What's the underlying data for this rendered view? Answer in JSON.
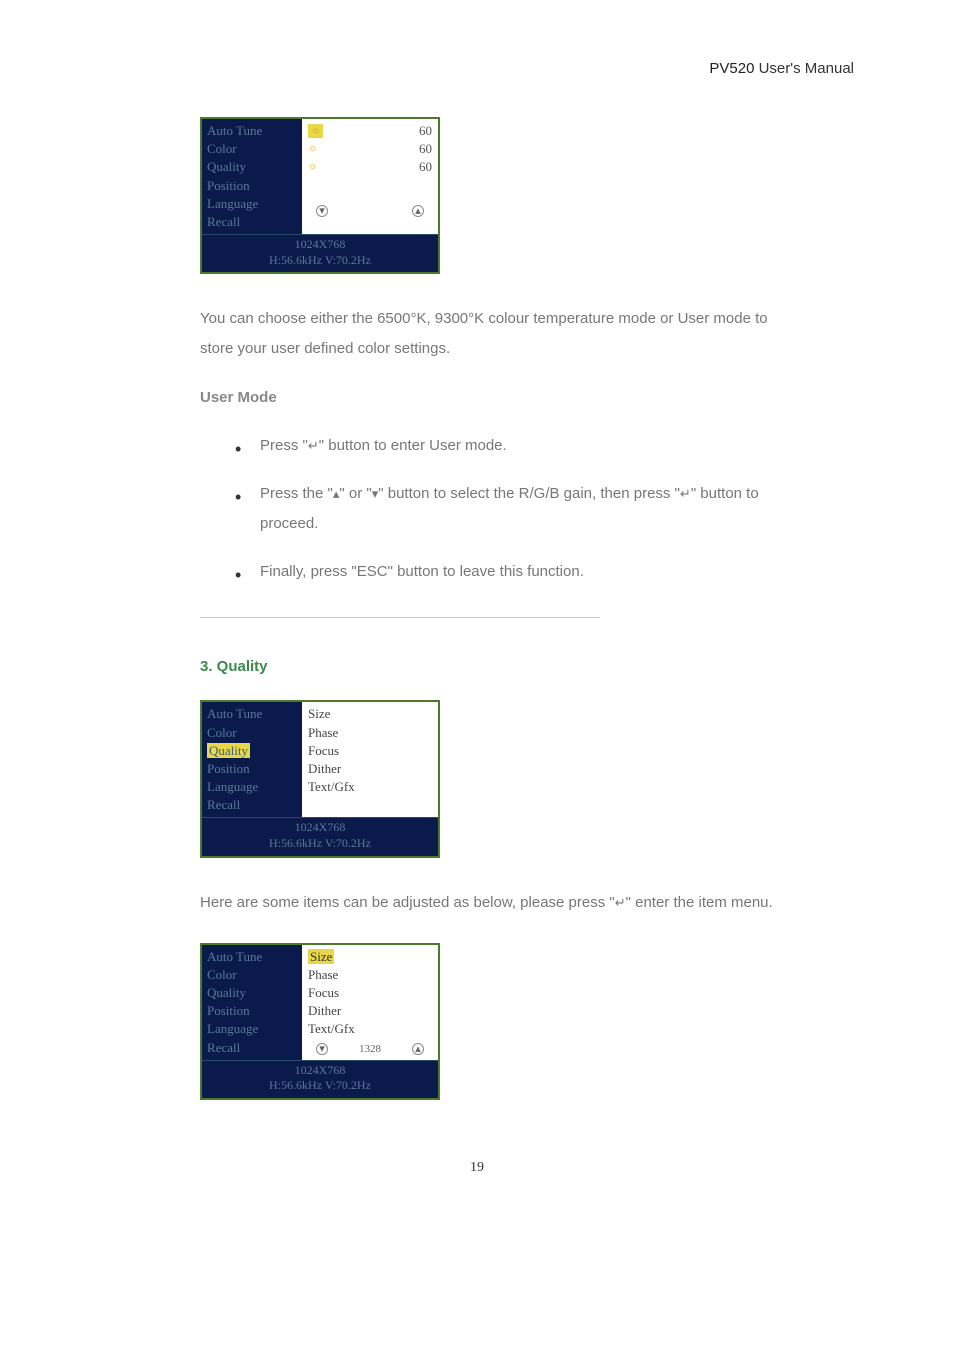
{
  "header": {
    "model": "PV520",
    "title": "User's Manual"
  },
  "osd1": {
    "menuItems": [
      "Auto Tune",
      "Color",
      "Quality",
      "Position",
      "Language",
      "Recall"
    ],
    "values": [
      "60",
      "60",
      "60"
    ],
    "resolution": "1024X768",
    "frequency": "H:56.6kHz V:70.2Hz"
  },
  "text1": "You can choose either the 6500°K, 9300°K colour temperature mode or User mode to store your user defined color settings.",
  "userModeHeading": "User Mode",
  "bullets": {
    "b1_pre": "Press \"",
    "b1_post": "\" button to enter User mode.",
    "b2_pre": "Press the \"",
    "b2_mid1": "\" or \"",
    "b2_mid2": "\" button to select the R/G/B gain, then press \"",
    "b2_post": "\" button to proceed.",
    "b3": "Finally, press \"ESC\" button to leave this function."
  },
  "section3Heading": "3. Quality",
  "osd2": {
    "menuItems": [
      "Auto Tune",
      "Color",
      "Quality",
      "Position",
      "Language",
      "Recall"
    ],
    "highlightedIndex": 2,
    "rightItems": [
      "Size",
      "Phase",
      "Focus",
      "Dither",
      "Text/Gfx"
    ],
    "resolution": "1024X768",
    "frequency": "H:56.6kHz V:70.2Hz"
  },
  "text2_pre": "Here are some items can be adjusted as below, please press \"",
  "text2_post": "\" enter the item menu.",
  "osd3": {
    "menuItems": [
      "Auto Tune",
      "Color",
      "Quality",
      "Position",
      "Language",
      "Recall"
    ],
    "rightItems": [
      "Size",
      "Phase",
      "Focus",
      "Dither",
      "Text/Gfx"
    ],
    "highlightedRightIndex": 0,
    "sliderValue": "1328",
    "resolution": "1024X768",
    "frequency": "H:56.6kHz V:70.2Hz"
  },
  "pageNumber": "19",
  "icons": {
    "enter": "↵",
    "up": "▴",
    "down": "▾",
    "sun": "☼"
  }
}
